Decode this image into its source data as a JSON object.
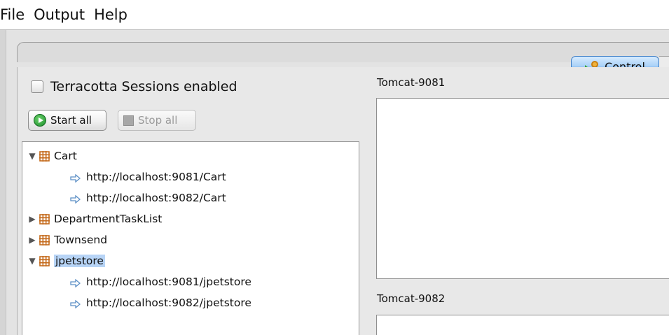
{
  "menu": {
    "items": [
      "File",
      "Output",
      "Help"
    ]
  },
  "tabs": {
    "control_label": "Control"
  },
  "sessions": {
    "checkbox_label": "Terracotta Sessions enabled",
    "checked": false
  },
  "buttons": {
    "start_all": "Start all",
    "stop_all": "Stop all"
  },
  "tree": {
    "rows": [
      {
        "label": "Cart",
        "kind": "app",
        "expanded": true,
        "selected": false
      },
      {
        "label": "http://localhost:9081/Cart",
        "kind": "link"
      },
      {
        "label": "http://localhost:9082/Cart",
        "kind": "link"
      },
      {
        "label": "DepartmentTaskList",
        "kind": "app",
        "expanded": false,
        "selected": false
      },
      {
        "label": "Townsend",
        "kind": "app",
        "expanded": false,
        "selected": false
      },
      {
        "label": "jpetstore",
        "kind": "app",
        "expanded": true,
        "selected": true
      },
      {
        "label": "http://localhost:9081/jpetstore",
        "kind": "link"
      },
      {
        "label": "http://localhost:9082/jpetstore",
        "kind": "link"
      }
    ]
  },
  "servers": {
    "first_title": "Tomcat-9081",
    "second_title": "Tomcat-9082"
  },
  "colors": {
    "app_icon": "#c46a1b",
    "link_arrow": "#5c8fc5",
    "selection": "#b7d4f6",
    "tab_active": "#a8d0f7"
  }
}
